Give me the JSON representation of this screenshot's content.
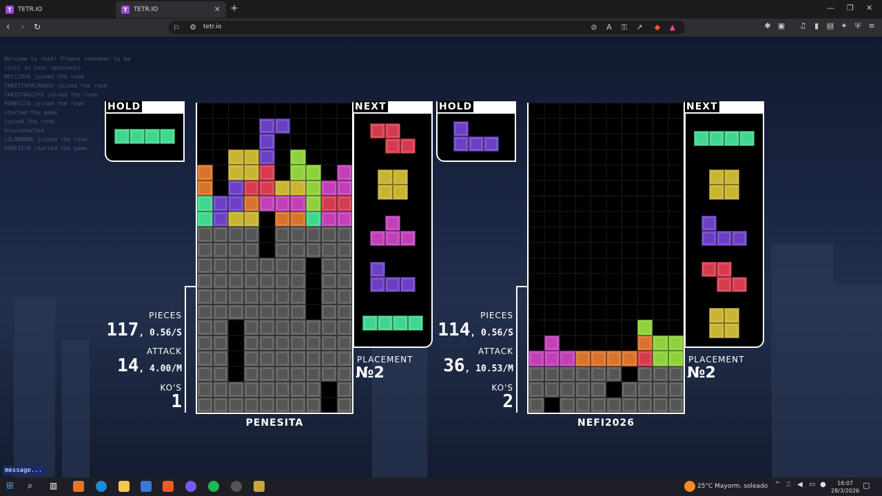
{
  "browser": {
    "tabs": [
      {
        "title": "TETR.IO",
        "active": false
      },
      {
        "title": "TETR.IO",
        "active": true
      }
    ],
    "url": "tetr.io"
  },
  "chat": {
    "lines": [
      "Welcome to chat! Please remember to be",
      "civil in your opponents.",
      "NEFI2026 joined the room",
      "TAKISTAPACABADO joined the room",
      "TAKISTAGG3YO joined the room",
      "PENESITA joined the room",
      "started the game",
      "joined the room",
      "disconnected",
      "LOLAMANDO joined the room",
      "PENESITA started the game"
    ],
    "input_placeholder": "message..."
  },
  "colors": {
    "I": "#3fd68e",
    "O": "#c9b32f",
    "T": "#c23fb8",
    "J": "#6a3fc4",
    "L": "#d9722a",
    "S": "#8fd13a",
    "Z": "#d63a4e",
    "G": "#555555"
  },
  "players": [
    {
      "name": "PENESITA",
      "hold": "I",
      "next": [
        "Z",
        "O",
        "T",
        "J",
        "I"
      ],
      "stats": {
        "pieces_label": "PIECES",
        "pieces": "117",
        "pieces_rate": "0.56/S",
        "attack_label": "ATTACK",
        "attack": "14",
        "attack_rate": "4.00/M",
        "kos_label": "KO'S",
        "kos": "1"
      },
      "placement_label": "PLACEMENT",
      "placement": "№2",
      "board": [
        "..........",
        "....JJ....",
        "....J.....",
        "..OOJ.S...",
        "L.OOZ.SS.T",
        "L.JZZOOSTT",
        "IJJLTTTSZZ",
        "IJOO.LLITT",
        "GGGG.GGGGG",
        "GGGG.GGGGG",
        "GGGGGGG.GG",
        "GGGGGGG.GG",
        "GGGGGGG.GG",
        "GGGGGGG.GG",
        "GG.GGGGGGG",
        "GG.GGGGGGG",
        "GG.GGGGGGG",
        "GG.GGGGGGG",
        "GGGGGGGG.G",
        "GGGGGGGG.G"
      ]
    },
    {
      "name": "NEFI2026",
      "hold": "J",
      "next": [
        "I",
        "O",
        "J",
        "Z",
        "O"
      ],
      "stats": {
        "pieces_label": "PIECES",
        "pieces": "114",
        "pieces_rate": "0.56/S",
        "attack_label": "ATTACK",
        "attack": "36",
        "attack_rate": "10.53/M",
        "kos_label": "KO'S",
        "kos": "2"
      },
      "placement_label": "PLACEMENT",
      "placement": "№2",
      "board": [
        "..........",
        "..........",
        "..........",
        "..........",
        "..........",
        "..........",
        "..........",
        "..........",
        "..........",
        "..........",
        "..........",
        "..........",
        "..........",
        "..........",
        ".......S..",
        ".T.....LSS",
        "TTTLLLLZSSS",
        "GGGGGG.GGG",
        "GGGGG.GGGG",
        "G.GGGGGGGG"
      ]
    }
  ],
  "labels": {
    "hold": "HOLD",
    "next": "NEXT"
  },
  "taskbar": {
    "weather": "25°C  Mayorm. soleado",
    "time": "16:07",
    "date": "28/3/2026"
  }
}
